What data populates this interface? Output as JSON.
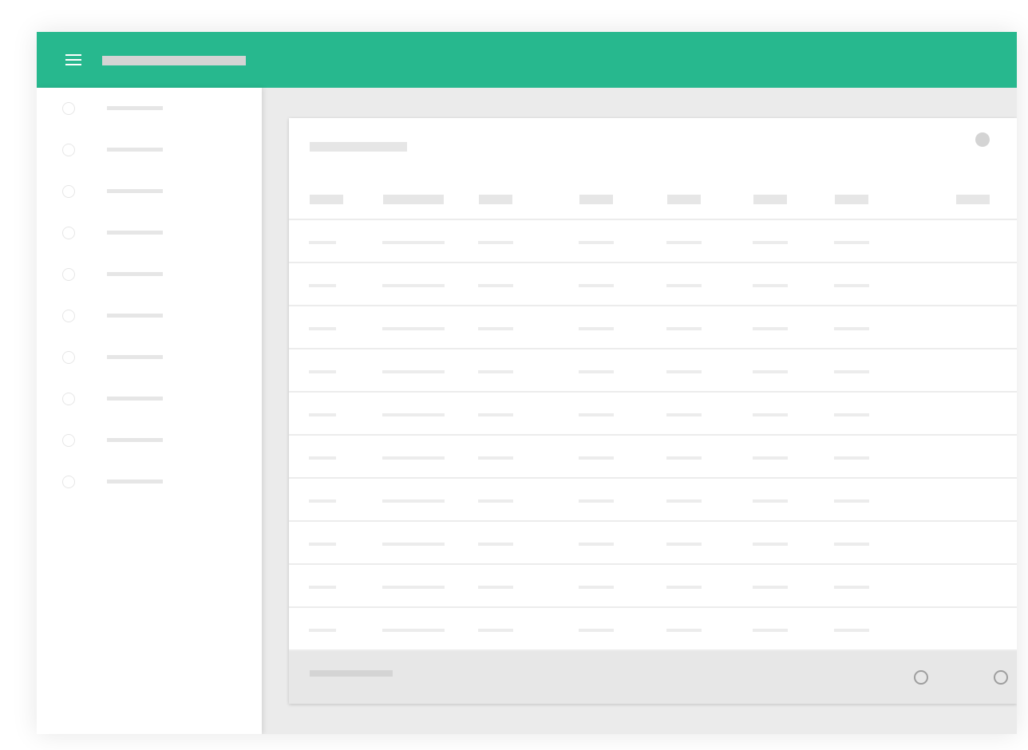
{
  "colors": {
    "accent": "#27b88e",
    "placeholder_light": "#ececec",
    "placeholder_header": "#e6e6e6",
    "placeholder_dark": "#d4d4d4",
    "background": "#ebebeb",
    "surface": "#ffffff"
  },
  "appbar": {
    "menu_icon": "menu-icon",
    "title": ""
  },
  "sidebar": {
    "items": [
      {
        "icon": "radio-icon",
        "label": ""
      },
      {
        "icon": "radio-icon",
        "label": ""
      },
      {
        "icon": "radio-icon",
        "label": ""
      },
      {
        "icon": "radio-icon",
        "label": ""
      },
      {
        "icon": "radio-icon",
        "label": ""
      },
      {
        "icon": "radio-icon",
        "label": ""
      },
      {
        "icon": "radio-icon",
        "label": ""
      },
      {
        "icon": "radio-icon",
        "label": ""
      },
      {
        "icon": "radio-icon",
        "label": ""
      },
      {
        "icon": "radio-icon",
        "label": ""
      }
    ]
  },
  "card": {
    "title": "",
    "action_icon": "more-icon",
    "columns": [
      "",
      "",
      "",
      "",
      "",
      "",
      "",
      ""
    ],
    "rows": [
      [
        "",
        "",
        "",
        "",
        "",
        "",
        ""
      ],
      [
        "",
        "",
        "",
        "",
        "",
        "",
        ""
      ],
      [
        "",
        "",
        "",
        "",
        "",
        "",
        ""
      ],
      [
        "",
        "",
        "",
        "",
        "",
        "",
        ""
      ],
      [
        "",
        "",
        "",
        "",
        "",
        "",
        ""
      ],
      [
        "",
        "",
        "",
        "",
        "",
        "",
        ""
      ],
      [
        "",
        "",
        "",
        "",
        "",
        "",
        ""
      ],
      [
        "",
        "",
        "",
        "",
        "",
        "",
        ""
      ],
      [
        "",
        "",
        "",
        "",
        "",
        "",
        ""
      ],
      [
        "",
        "",
        "",
        "",
        "",
        "",
        ""
      ]
    ],
    "footer": {
      "text": "",
      "prev_icon": "circle-icon",
      "next_icon": "circle-icon"
    }
  }
}
